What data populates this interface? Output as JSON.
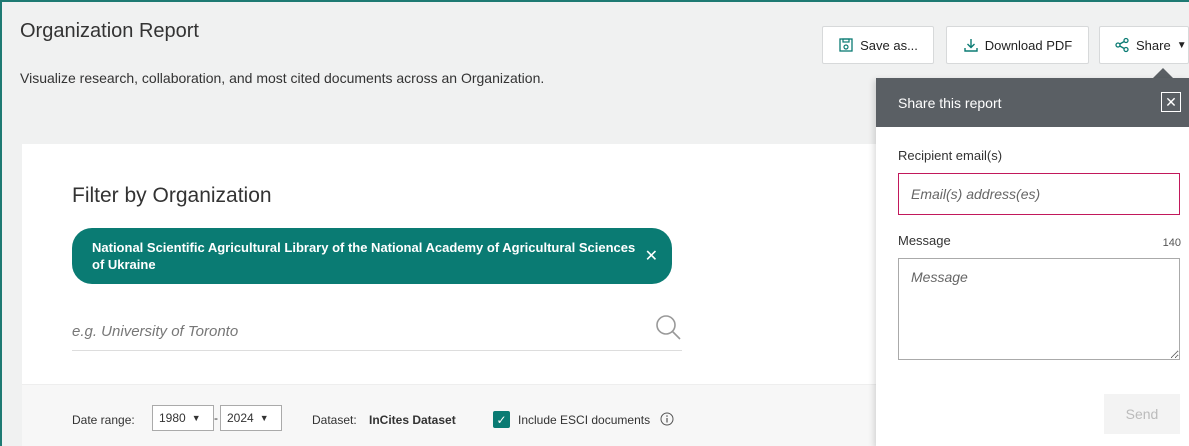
{
  "header": {
    "title": "Organization Report",
    "subtitle": "Visualize research, collaboration, and most cited documents across an Organization."
  },
  "toolbar": {
    "save_label": "Save as...",
    "download_label": "Download PDF",
    "share_label": "Share"
  },
  "filter": {
    "heading": "Filter by Organization",
    "selected_org": "National Scientific Agricultural Library of the National Academy of Agricultural Sciences of Ukraine",
    "search_placeholder": "e.g. University of Toronto"
  },
  "controls": {
    "date_range_label": "Date range:",
    "date_from": "1980",
    "date_to": "2024",
    "dataset_label": "Dataset:",
    "dataset_value": "InCites Dataset",
    "esci_label": "Include ESCI documents",
    "esci_checked": true
  },
  "share_panel": {
    "title": "Share this report",
    "recipient_label": "Recipient email(s)",
    "email_placeholder": "Email(s) address(es)",
    "message_label": "Message",
    "message_count": "140",
    "message_placeholder": "Message",
    "send_label": "Send"
  },
  "colors": {
    "accent": "#0a7b73",
    "panel_header": "#5a5f64",
    "invalid_border": "#c2185b"
  },
  "icons": {
    "save": "save-icon",
    "download": "download-icon",
    "share": "share-icon",
    "search": "search-icon",
    "info": "info-icon",
    "close": "close-icon"
  }
}
